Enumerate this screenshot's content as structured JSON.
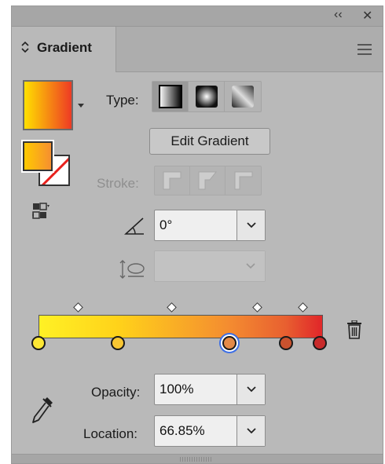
{
  "window": {
    "collapse_glyph": "‹‹",
    "close_glyph": "✕"
  },
  "panel_tab": {
    "chevron_glyph": "⌃⌄",
    "title": "Gradient",
    "menu_icon": "hamburger-menu-icon"
  },
  "swatch": {
    "gradient_from": "#ffe000",
    "gradient_to": "#ee3a24",
    "fill_from": "#ffca00",
    "fill_to": "#f68f30"
  },
  "type_row": {
    "label": "Type:",
    "options": [
      "linear-gradient-icon",
      "radial-gradient-icon",
      "freeform-gradient-icon"
    ],
    "active": 0
  },
  "edit_gradient": {
    "label": "Edit Gradient"
  },
  "stroke_row": {
    "label": "Stroke:",
    "options": [
      "stroke-within-icon",
      "stroke-along-icon",
      "stroke-across-icon"
    ]
  },
  "angle": {
    "icon": "angle-icon",
    "value": "0°"
  },
  "aspect": {
    "icon": "aspect-ratio-icon",
    "value": ""
  },
  "gradient_slider": {
    "colors": [
      "#fff125",
      "#ffd21a",
      "#f48c30",
      "#e86030",
      "#e12a2a"
    ],
    "color_positions": [
      0,
      0.28,
      0.67,
      0.87,
      0.99
    ],
    "stops": [
      {
        "position": 0.0,
        "color": "#fde734"
      },
      {
        "position": 0.28,
        "color": "#f8c632"
      },
      {
        "position": 0.67,
        "color": "#e48a48",
        "selected": true
      },
      {
        "position": 0.87,
        "color": "#c9522e"
      },
      {
        "position": 0.99,
        "color": "#c82a2a"
      }
    ],
    "midpoints": [
      0.14,
      0.47,
      0.77,
      0.93
    ]
  },
  "opacity": {
    "label": "Opacity:",
    "value": "100%"
  },
  "location": {
    "label": "Location:",
    "value": "66.85%"
  }
}
